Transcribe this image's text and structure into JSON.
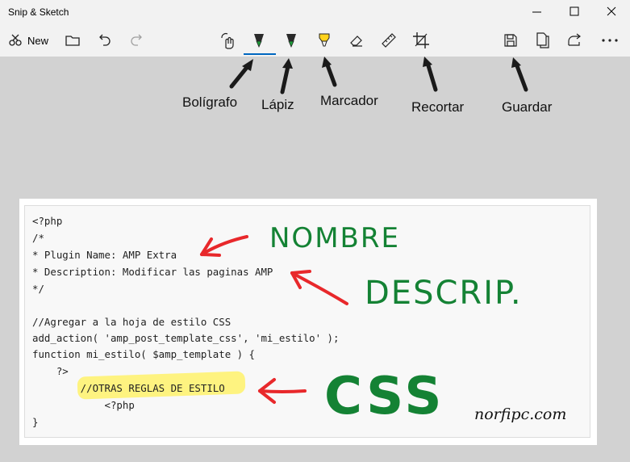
{
  "app": {
    "title": "Snip & Sketch"
  },
  "toolbar": {
    "new_label": "New",
    "icons": [
      "new-snip-icon",
      "folder-icon",
      "undo-icon",
      "redo-icon",
      "touch-writing-icon",
      "ballpoint-pen-icon",
      "pencil-icon",
      "highlighter-icon",
      "eraser-icon",
      "ruler-icon",
      "crop-icon",
      "save-icon",
      "copy-icon",
      "share-icon",
      "more-icon"
    ]
  },
  "annotations": {
    "boligrafo": "Bolígrafo",
    "lapiz": "Lápiz",
    "marcador": "Marcador",
    "recortar": "Recortar",
    "guardar": "Guardar"
  },
  "code": {
    "lines": [
      "<?php",
      "/*",
      "* Plugin Name: AMP Extra",
      "* Description: Modificar las paginas AMP",
      "*/",
      "",
      "//Agregar a la hoja de estilo CSS",
      "add_action( 'amp_post_template_css', 'mi_estilo' );",
      "function mi_estilo( $amp_template ) {",
      "    ?>",
      "        //OTRAS REGLAS DE ESTILO",
      "            <?php",
      "}"
    ]
  },
  "handwriting": {
    "nombre": "NOMBRE",
    "descrip": "DESCRIP.",
    "css": "CSS"
  },
  "watermark": "norfipc.com",
  "colors": {
    "ink_green": "#148234",
    "ink_red": "#e8282b",
    "highlight": "#fff26b",
    "accent": "#0067c0"
  }
}
